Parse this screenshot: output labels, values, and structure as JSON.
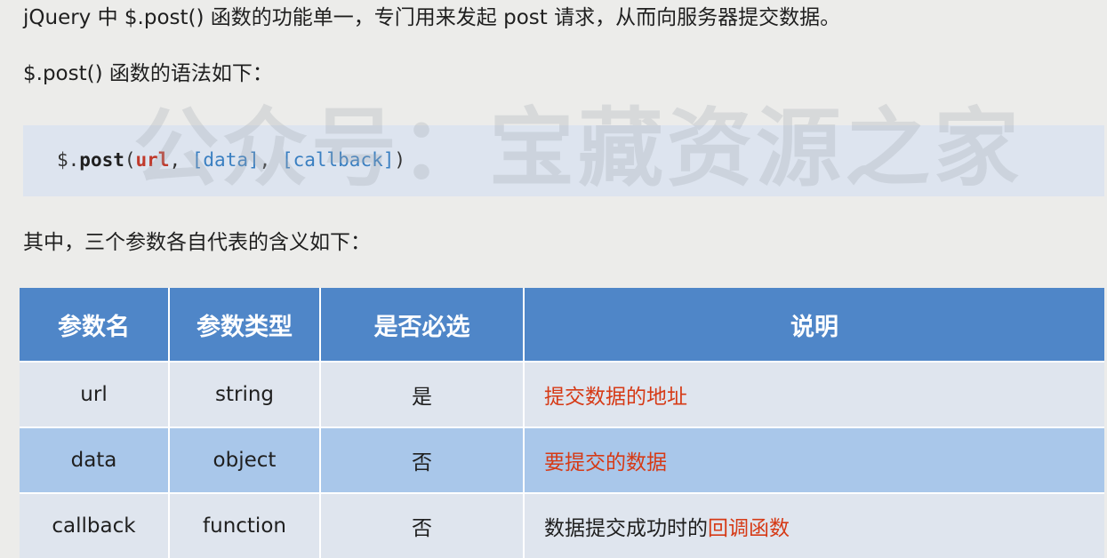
{
  "intro": {
    "line1": "jQuery 中 $.post() 函数的功能单一，专门用来发起 post 请求，从而向服务器提交数据。",
    "line2": "$.post() 函数的语法如下：",
    "line3": "其中，三个参数各自代表的含义如下："
  },
  "code": {
    "prefix": "$.",
    "func": "post",
    "open": "(",
    "param_url": "url",
    "sep1": ", ",
    "param_data": "[data]",
    "sep2": ", ",
    "param_callback": "[callback]",
    "close": ")"
  },
  "watermark": "公众号：宝藏资源之家",
  "table": {
    "headers": [
      "参数名",
      "参数类型",
      "是否必选",
      "说明"
    ],
    "rows": [
      {
        "name": "url",
        "type": "string",
        "required": "是",
        "desc_plain": "",
        "desc_highlight": "提交数据的地址"
      },
      {
        "name": "data",
        "type": "object",
        "required": "否",
        "desc_plain": "",
        "desc_highlight": "要提交的数据"
      },
      {
        "name": "callback",
        "type": "function",
        "required": "否",
        "desc_plain": "数据提交成功时的",
        "desc_highlight": "回调函数"
      }
    ]
  },
  "colors": {
    "header_bg": "#4f86c8",
    "row_odd_bg": "#dfe5ee",
    "row_even_bg": "#a9c7ea",
    "highlight_red": "#d63a16",
    "code_param_red": "#c0392b",
    "code_optional_blue": "#3a7fc1"
  }
}
